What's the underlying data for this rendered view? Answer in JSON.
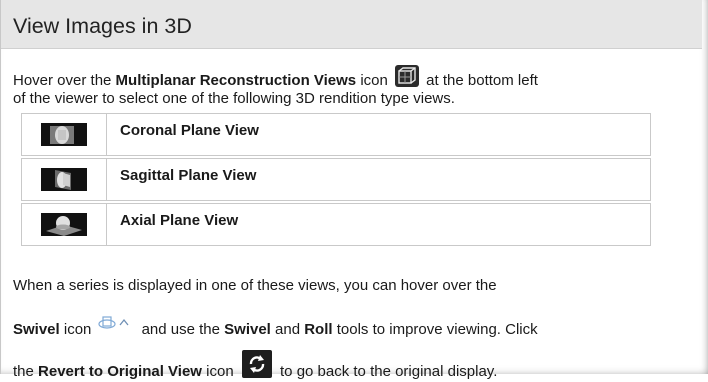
{
  "header": {
    "title": "View Images in 3D"
  },
  "intro": {
    "part1": "Hover over the ",
    "bold1": "Multiplanar Reconstruction Views",
    "part2": " icon ",
    "part3": " at the bottom left",
    "line2": "of the viewer to select one of the following 3D rendition type views.",
    "icon": "multiplanar-reconstruction-views-icon"
  },
  "views": [
    {
      "label": "Coronal Plane View",
      "icon": "coronal-plane-icon"
    },
    {
      "label": "Sagittal Plane View",
      "icon": "sagittal-plane-icon"
    },
    {
      "label": "Axial Plane View",
      "icon": "axial-plane-icon"
    }
  ],
  "body": {
    "line1": "When a series is displayed in one of these views, you can hover over the",
    "swivel_bold": "Swivel",
    "swivel_after_icon": "icon",
    "and_use_the": " and use the ",
    "swivel_bold_2": "Swivel",
    "and": " and ",
    "roll_bold": "Roll",
    "tools_text": " tools to improve viewing. Click",
    "the": "the ",
    "revert_bold": "Revert to Original View",
    "icon_word": " icon ",
    "ending": " to go back to the original display.",
    "swivel_icon": "swivel-icon",
    "revert_icon": "revert-icon"
  }
}
